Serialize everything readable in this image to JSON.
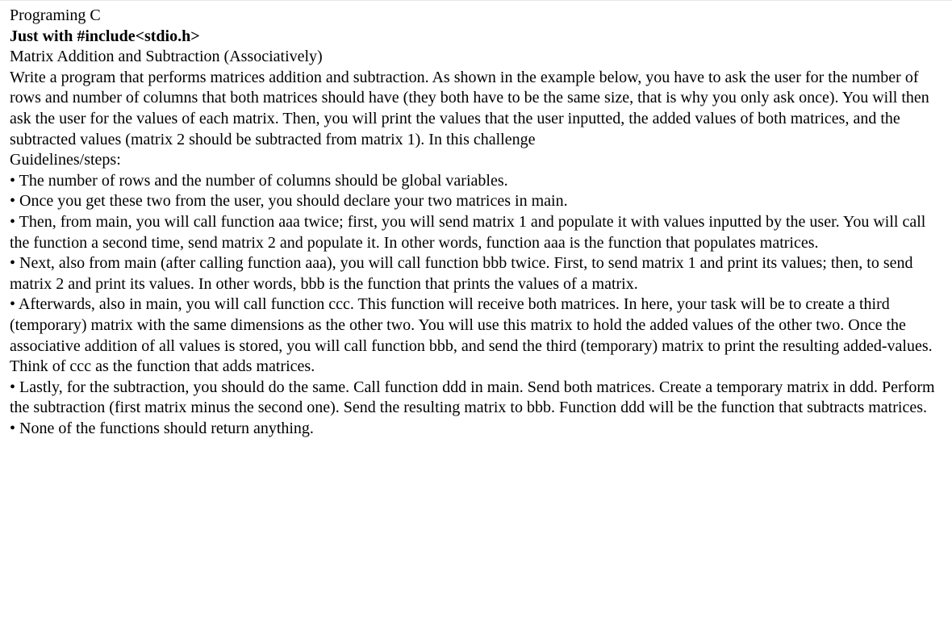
{
  "document": {
    "title_line1": "Programing C",
    "title_line2": "Just with #include<stdio.h>",
    "section_title": "Matrix Addition and Subtraction (Associatively)",
    "intro": "Write a program that performs matrices addition and subtraction. As shown in the example below, you have to ask the user for the number of rows and number of columns that both matrices should have (they both have to be the same size, that is why you only ask once). You will then ask the user for the values of each matrix. Then, you will print the values that the user inputted, the added values of both matrices, and the subtracted values (matrix 2 should be subtracted from matrix 1). In this challenge",
    "guidelines_heading": "Guidelines/steps:",
    "bullets": [
      "• The number of rows and the number of columns should be global variables.",
      "• Once you get these two from the user, you should declare your two matrices in main.",
      "• Then, from main, you will call function aaa twice; first, you will send matrix 1 and populate it with values inputted by the user. You will call the function a second time, send matrix 2 and populate it. In other words, function aaa is the function that populates matrices.",
      "• Next, also from main (after calling function aaa), you will call function bbb twice. First, to send matrix 1 and print its values; then, to send matrix 2 and print its values. In other words, bbb is the function that prints the values of a matrix.",
      "• Afterwards, also in main, you will call function ccc. This function will receive both matrices. In here, your task will be to create a third (temporary) matrix with the same dimensions as the other two. You will use this matrix to hold the added values of the other two. Once the associative addition of all values is stored, you will call function bbb, and send the third (temporary) matrix to print the resulting added-values. Think of ccc as the function that adds matrices.",
      "• Lastly, for the subtraction, you should do the same. Call function ddd in main. Send both matrices. Create a temporary matrix in ddd. Perform the subtraction (first matrix minus the second one). Send the resulting matrix to bbb. Function ddd will be the function that subtracts matrices.",
      "• None of the functions should return anything."
    ]
  }
}
